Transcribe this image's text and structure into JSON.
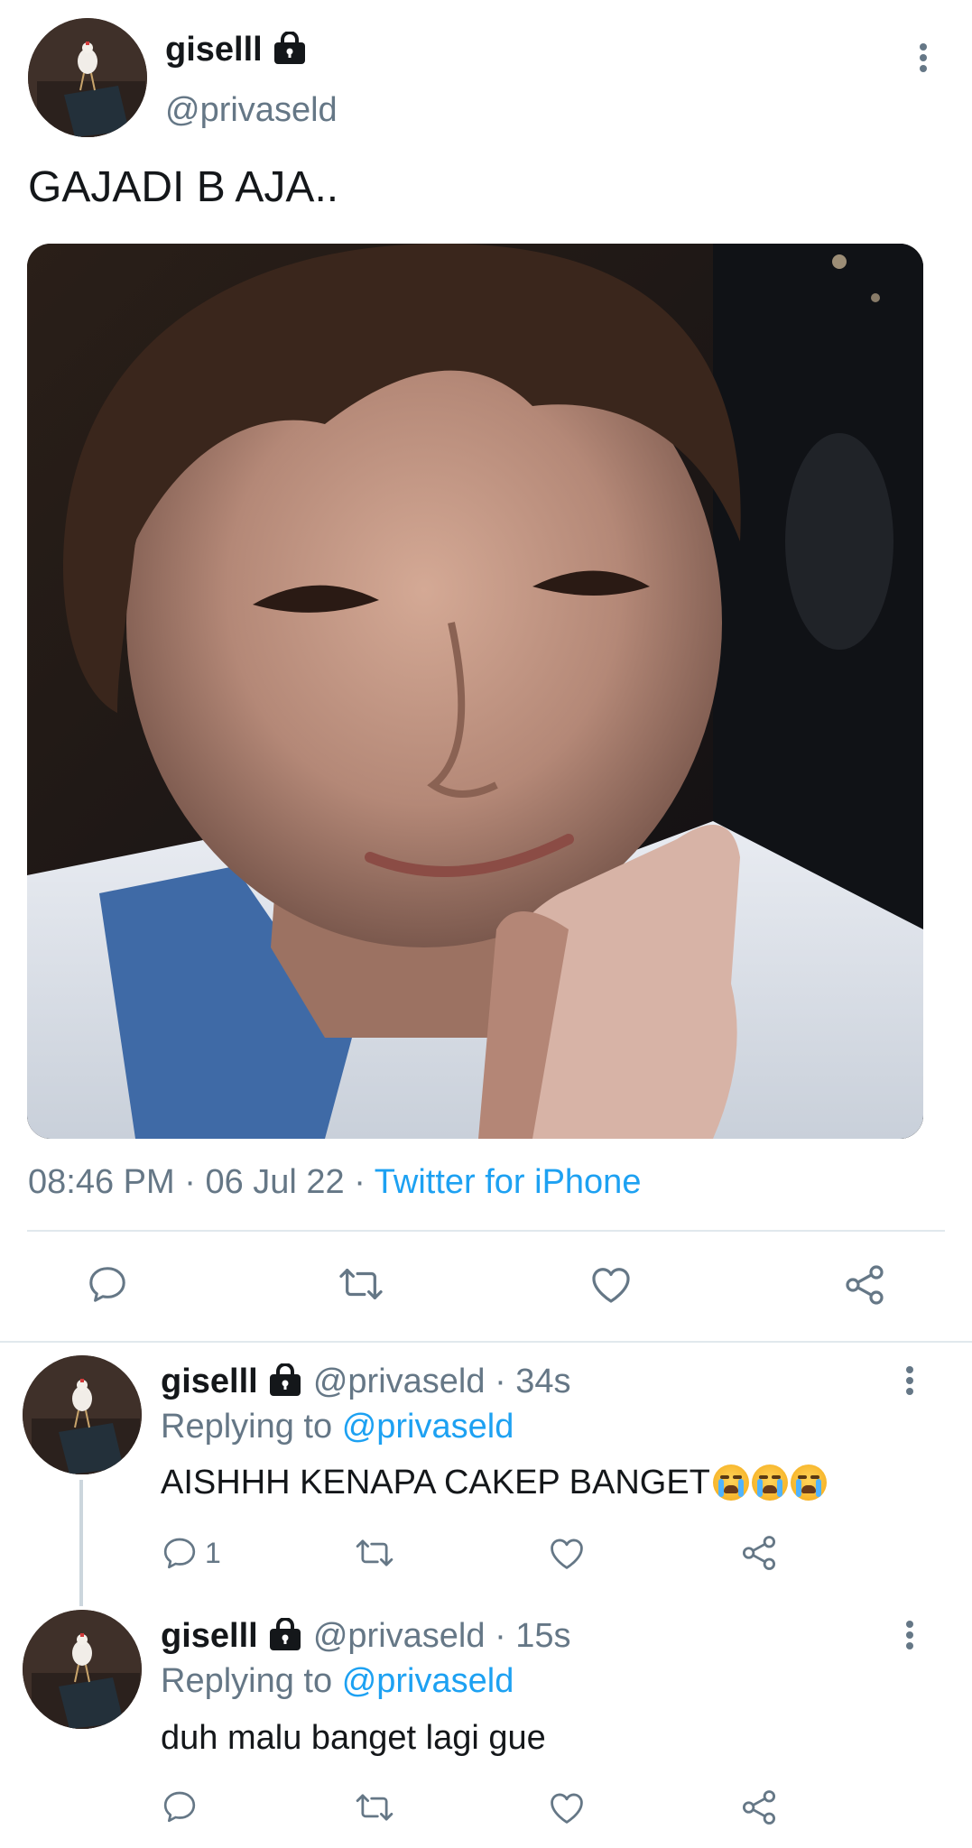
{
  "tweet": {
    "display_name": "giselll",
    "handle": "@privaseld",
    "text": "GAJADI B AJA..",
    "time": "08:46 PM",
    "sep1": "·",
    "date": "06 Jul 22",
    "sep2": "·",
    "source": "Twitter for iPhone",
    "icons": {
      "lock": "lock-icon",
      "more": "more-vertical-icon",
      "reply": "reply-icon",
      "retweet": "retweet-icon",
      "like": "heart-icon",
      "share": "share-icon"
    }
  },
  "replies": [
    {
      "display_name": "giselll",
      "handle": "@privaseld",
      "separator": "·",
      "age": "34s",
      "replying_prefix": "Replying to",
      "replying_to": "@privaseld",
      "text": "AISHHH KENAPA CAKEP BANGET",
      "emoji": [
        "loudly-crying-face",
        "loudly-crying-face",
        "loudly-crying-face"
      ],
      "reply_count": "1"
    },
    {
      "display_name": "giselll",
      "handle": "@privaseld",
      "separator": "·",
      "age": "15s",
      "replying_prefix": "Replying to",
      "replying_to": "@privaseld",
      "text": "duh malu banget lagi gue",
      "reply_count": ""
    }
  ],
  "colors": {
    "link": "#1da1f2",
    "secondary_text": "#657786",
    "divider": "#e1e8ed",
    "primary_text": "#14171a"
  }
}
